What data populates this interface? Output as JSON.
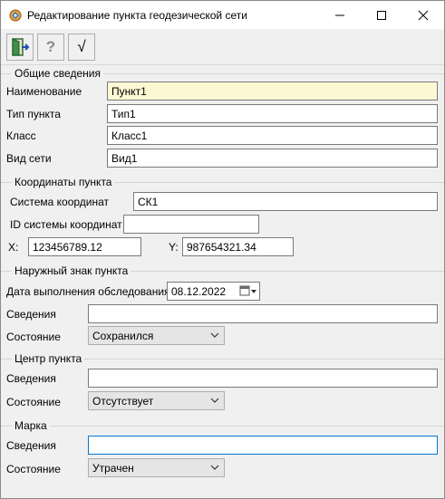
{
  "window": {
    "title": "Редактирование пункта геодезической сети"
  },
  "toolbar": {
    "exit_icon": "exit-door-icon",
    "help_label": "?",
    "ok_label": "√"
  },
  "general": {
    "title": "Общие сведения",
    "name_label": "Наименование",
    "name_value": "Пункт1",
    "type_label": "Тип пункта",
    "type_value": "Тип1",
    "class_label": "Класс",
    "class_value": "Класс1",
    "network_label": "Вид сети",
    "network_value": "Вид1"
  },
  "coords": {
    "title": "Координаты пункта",
    "system_label": "Система координат",
    "system_value": "СК1",
    "system_id_label": "ID системы координат",
    "system_id_value": "",
    "x_label": "X:",
    "x_value": "123456789.12",
    "y_label": "Y:",
    "y_value": "987654321.34"
  },
  "outer_sign": {
    "title": "Наружный знак пункта",
    "date_label": "Дата выполнения обследования",
    "date_value": "08.12.2022",
    "info_label": "Сведения",
    "info_value": "",
    "state_label": "Состояние",
    "state_value": "Сохранился"
  },
  "center": {
    "title": "Центр пункта",
    "info_label": "Сведения",
    "info_value": "",
    "state_label": "Состояние",
    "state_value": "Отсутствует"
  },
  "mark": {
    "title": "Марка",
    "info_label": "Сведения",
    "info_value": "",
    "state_label": "Состояние",
    "state_value": "Утрачен"
  }
}
